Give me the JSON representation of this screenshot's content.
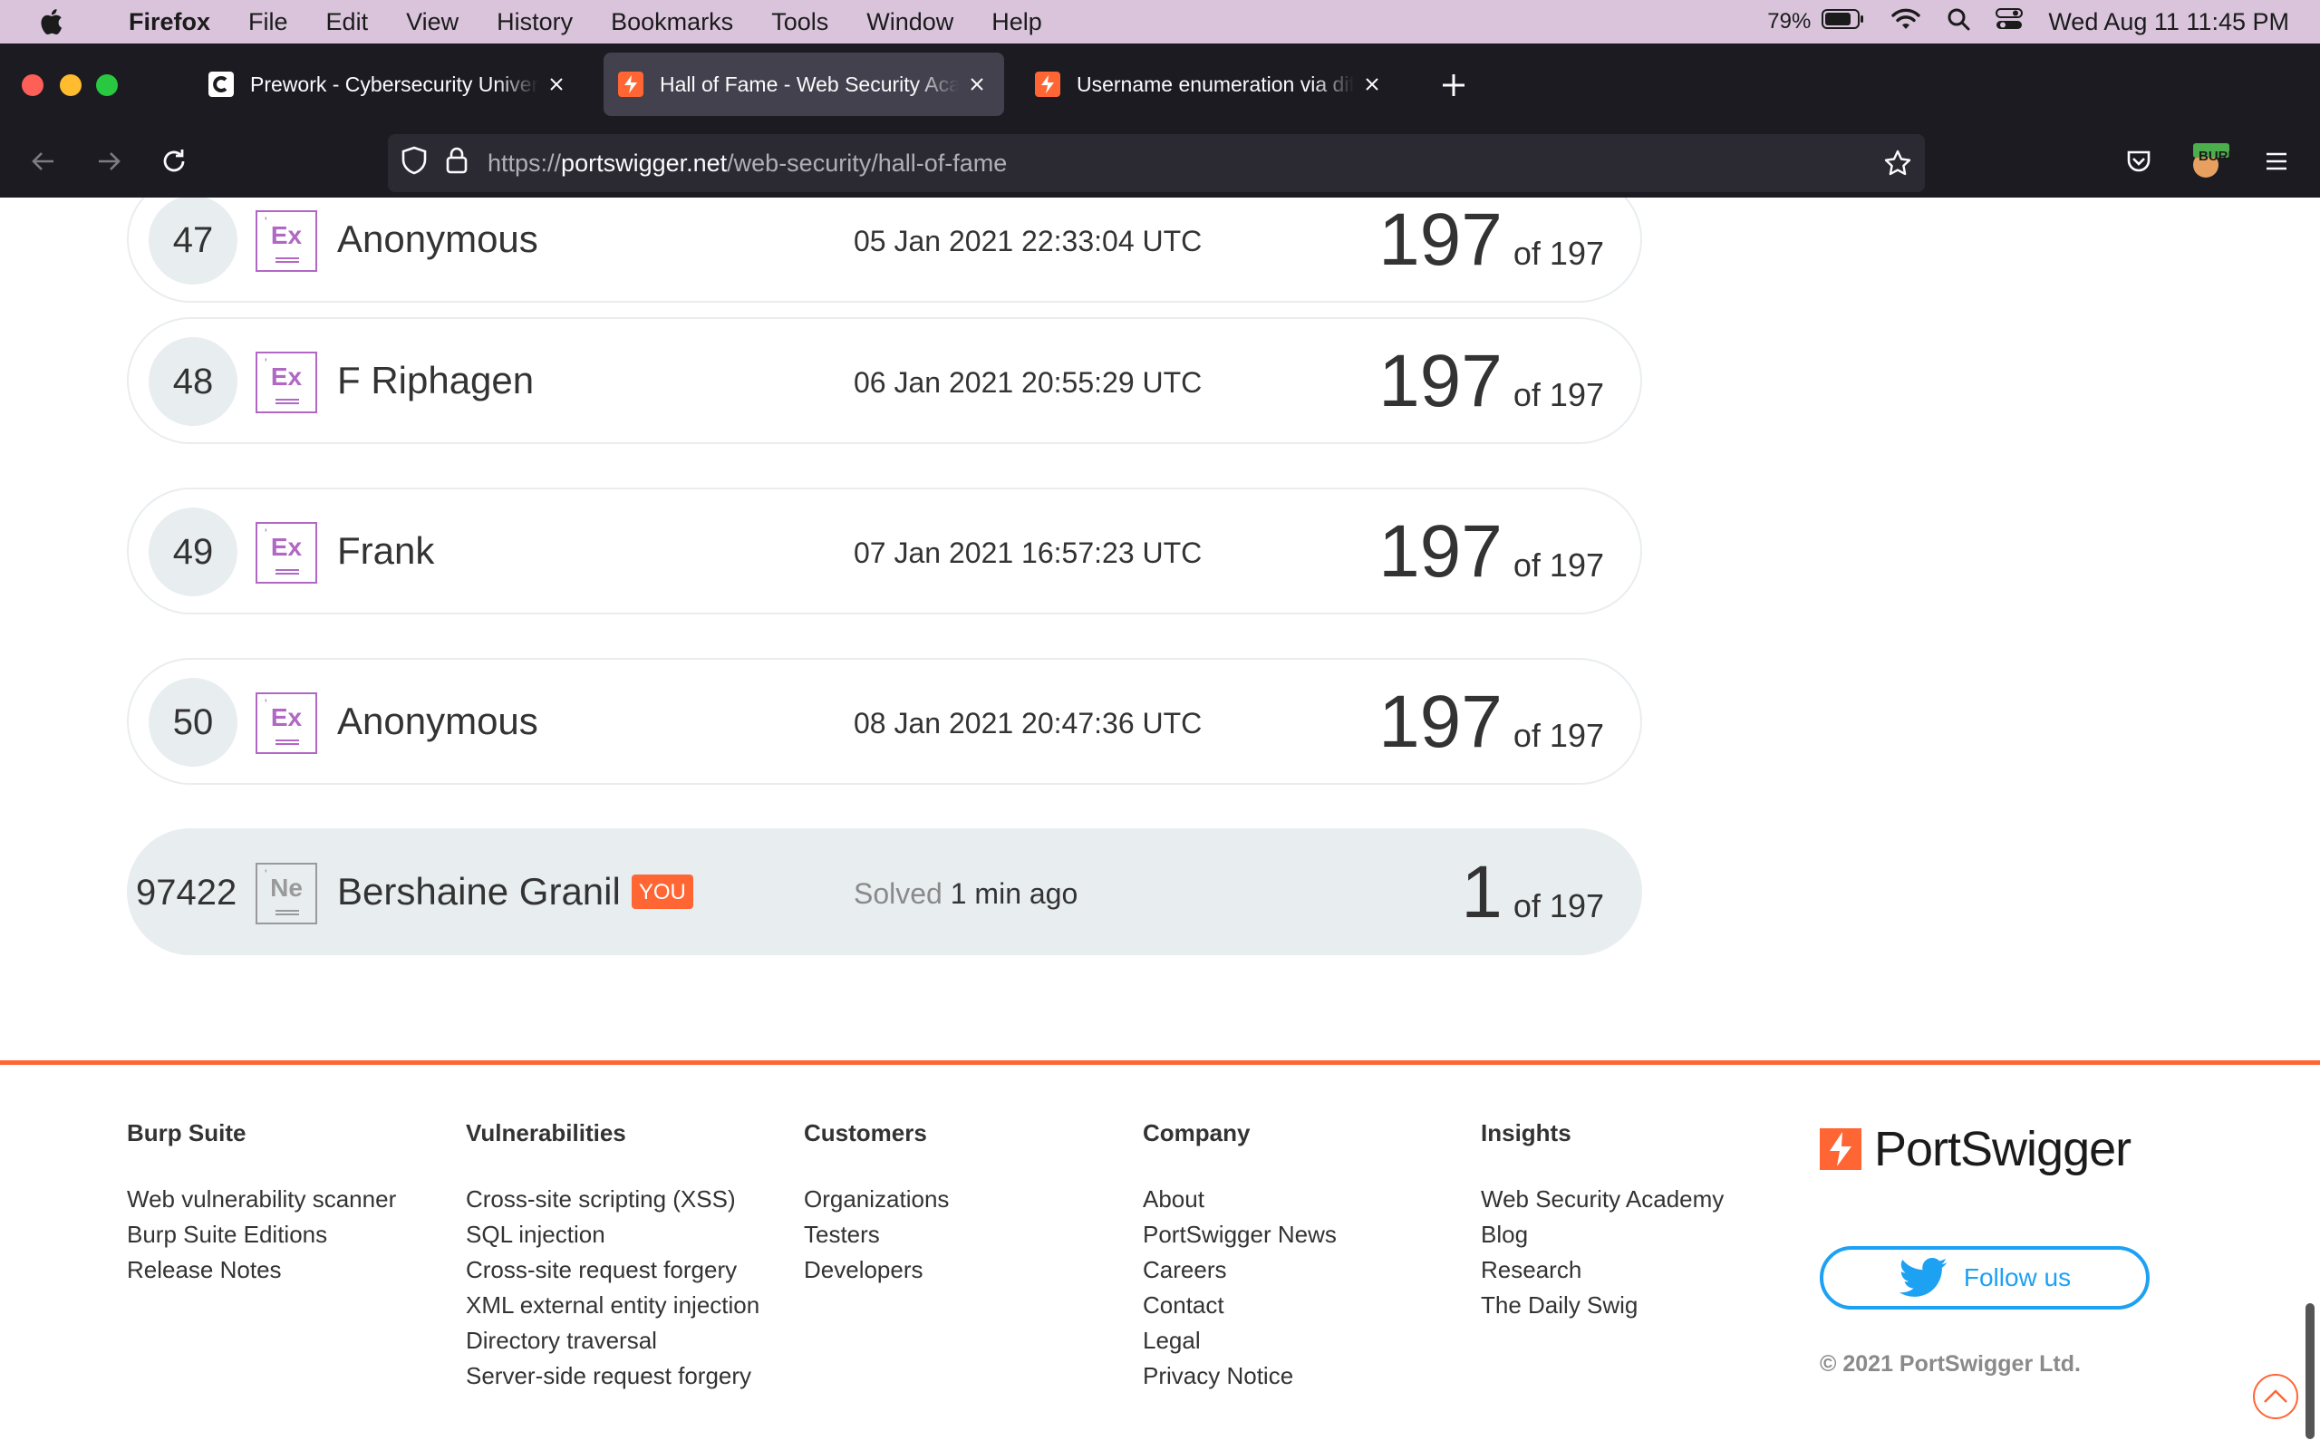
{
  "menubar": {
    "app": "Firefox",
    "items": [
      "File",
      "Edit",
      "View",
      "History",
      "Bookmarks",
      "Tools",
      "Window",
      "Help"
    ],
    "battery": "79%",
    "clock": "Wed Aug 11  11:45 PM"
  },
  "tabs": [
    {
      "title": "Prework - Cybersecurity University",
      "icon": "codepath-icon"
    },
    {
      "title": "Hall of Fame - Web Security Academy",
      "icon": "portswigger-icon"
    },
    {
      "title": "Username enumeration via different responses",
      "icon": "portswigger-icon"
    }
  ],
  "url": {
    "scheme": "https://",
    "host": "portswigger.net",
    "path": "/web-security/hall-of-fame"
  },
  "extension_label": "BURP",
  "rows": [
    {
      "rank": "47",
      "level": "Ex",
      "name": "Anonymous",
      "date": "05 Jan 2021 22:33:04 UTC",
      "score": "197",
      "total": "of 197"
    },
    {
      "rank": "48",
      "level": "Ex",
      "name": "F Riphagen",
      "date": "06 Jan 2021 20:55:29 UTC",
      "score": "197",
      "total": "of 197"
    },
    {
      "rank": "49",
      "level": "Ex",
      "name": "Frank",
      "date": "07 Jan 2021 16:57:23 UTC",
      "score": "197",
      "total": "of 197"
    },
    {
      "rank": "50",
      "level": "Ex",
      "name": "Anonymous",
      "date": "08 Jan 2021 20:47:36 UTC",
      "score": "197",
      "total": "of 197"
    }
  ],
  "you_row": {
    "rank": "97422",
    "level": "Ne",
    "name": "Bershaine Granil",
    "badge": "YOU",
    "solved_label": "Solved",
    "solved_time": "1 min ago",
    "score": "1",
    "total": "of 197"
  },
  "footer": {
    "columns": [
      {
        "heading": "Burp Suite",
        "links": [
          "Web vulnerability scanner",
          "Burp Suite Editions",
          "Release Notes"
        ]
      },
      {
        "heading": "Vulnerabilities",
        "links": [
          "Cross-site scripting (XSS)",
          "SQL injection",
          "Cross-site request forgery",
          "XML external entity injection",
          "Directory traversal",
          "Server-side request forgery"
        ]
      },
      {
        "heading": "Customers",
        "links": [
          "Organizations",
          "Testers",
          "Developers"
        ]
      },
      {
        "heading": "Company",
        "links": [
          "About",
          "PortSwigger News",
          "Careers",
          "Contact",
          "Legal",
          "Privacy Notice"
        ]
      },
      {
        "heading": "Insights",
        "links": [
          "Web Security Academy",
          "Blog",
          "Research",
          "The Daily Swig"
        ]
      }
    ],
    "brand": "PortSwigger",
    "follow": "Follow us",
    "copyright": "© 2021 PortSwigger Ltd."
  },
  "colors": {
    "accent": "#ff6633",
    "expert_purple": "#b068c4",
    "twitter": "#1da1f2",
    "chrome_bg": "#1c1b22",
    "menubar_bg": "#d9c4dc"
  }
}
